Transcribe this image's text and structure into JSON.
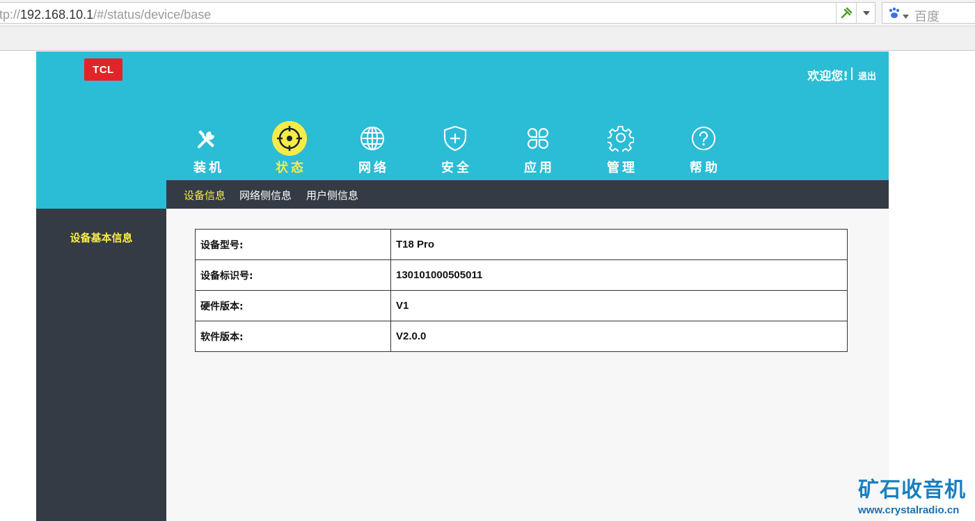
{
  "browser": {
    "url_prefix": "tp://",
    "url_host": "192.168.10.1",
    "url_path": "/#/status/device/base",
    "search_placeholder": "百度"
  },
  "header": {
    "logo_text": "TCL",
    "welcome": "欢迎您!",
    "logout": "退出"
  },
  "nav": {
    "items": [
      {
        "label": "装机",
        "icon": "tools-icon"
      },
      {
        "label": "状态",
        "icon": "status-target-icon"
      },
      {
        "label": "网络",
        "icon": "globe-icon"
      },
      {
        "label": "安全",
        "icon": "shield-plus-icon"
      },
      {
        "label": "应用",
        "icon": "apps-icon"
      },
      {
        "label": "管理",
        "icon": "gear-icon"
      },
      {
        "label": "帮助",
        "icon": "help-icon"
      }
    ],
    "active": "状态"
  },
  "subnav": {
    "items": [
      "设备信息",
      "网络侧信息",
      "用户侧信息"
    ],
    "active": "设备信息"
  },
  "sidebar": {
    "items": [
      "设备基本信息"
    ]
  },
  "device_info": {
    "rows": [
      {
        "label": "设备型号:",
        "value": "T18 Pro"
      },
      {
        "label": "设备标识号:",
        "value": "130101000505011"
      },
      {
        "label": "硬件版本:",
        "value": "V1"
      },
      {
        "label": "软件版本:",
        "value": "V2.0.0"
      }
    ]
  },
  "watermark": {
    "title": "矿石收音机",
    "url": "www.crystalradio.cn"
  },
  "colors": {
    "header_bg": "#2bbcd6",
    "dark_bg": "#343b45",
    "accent_yellow": "#f7ec46",
    "logo_red": "#e2232a"
  }
}
